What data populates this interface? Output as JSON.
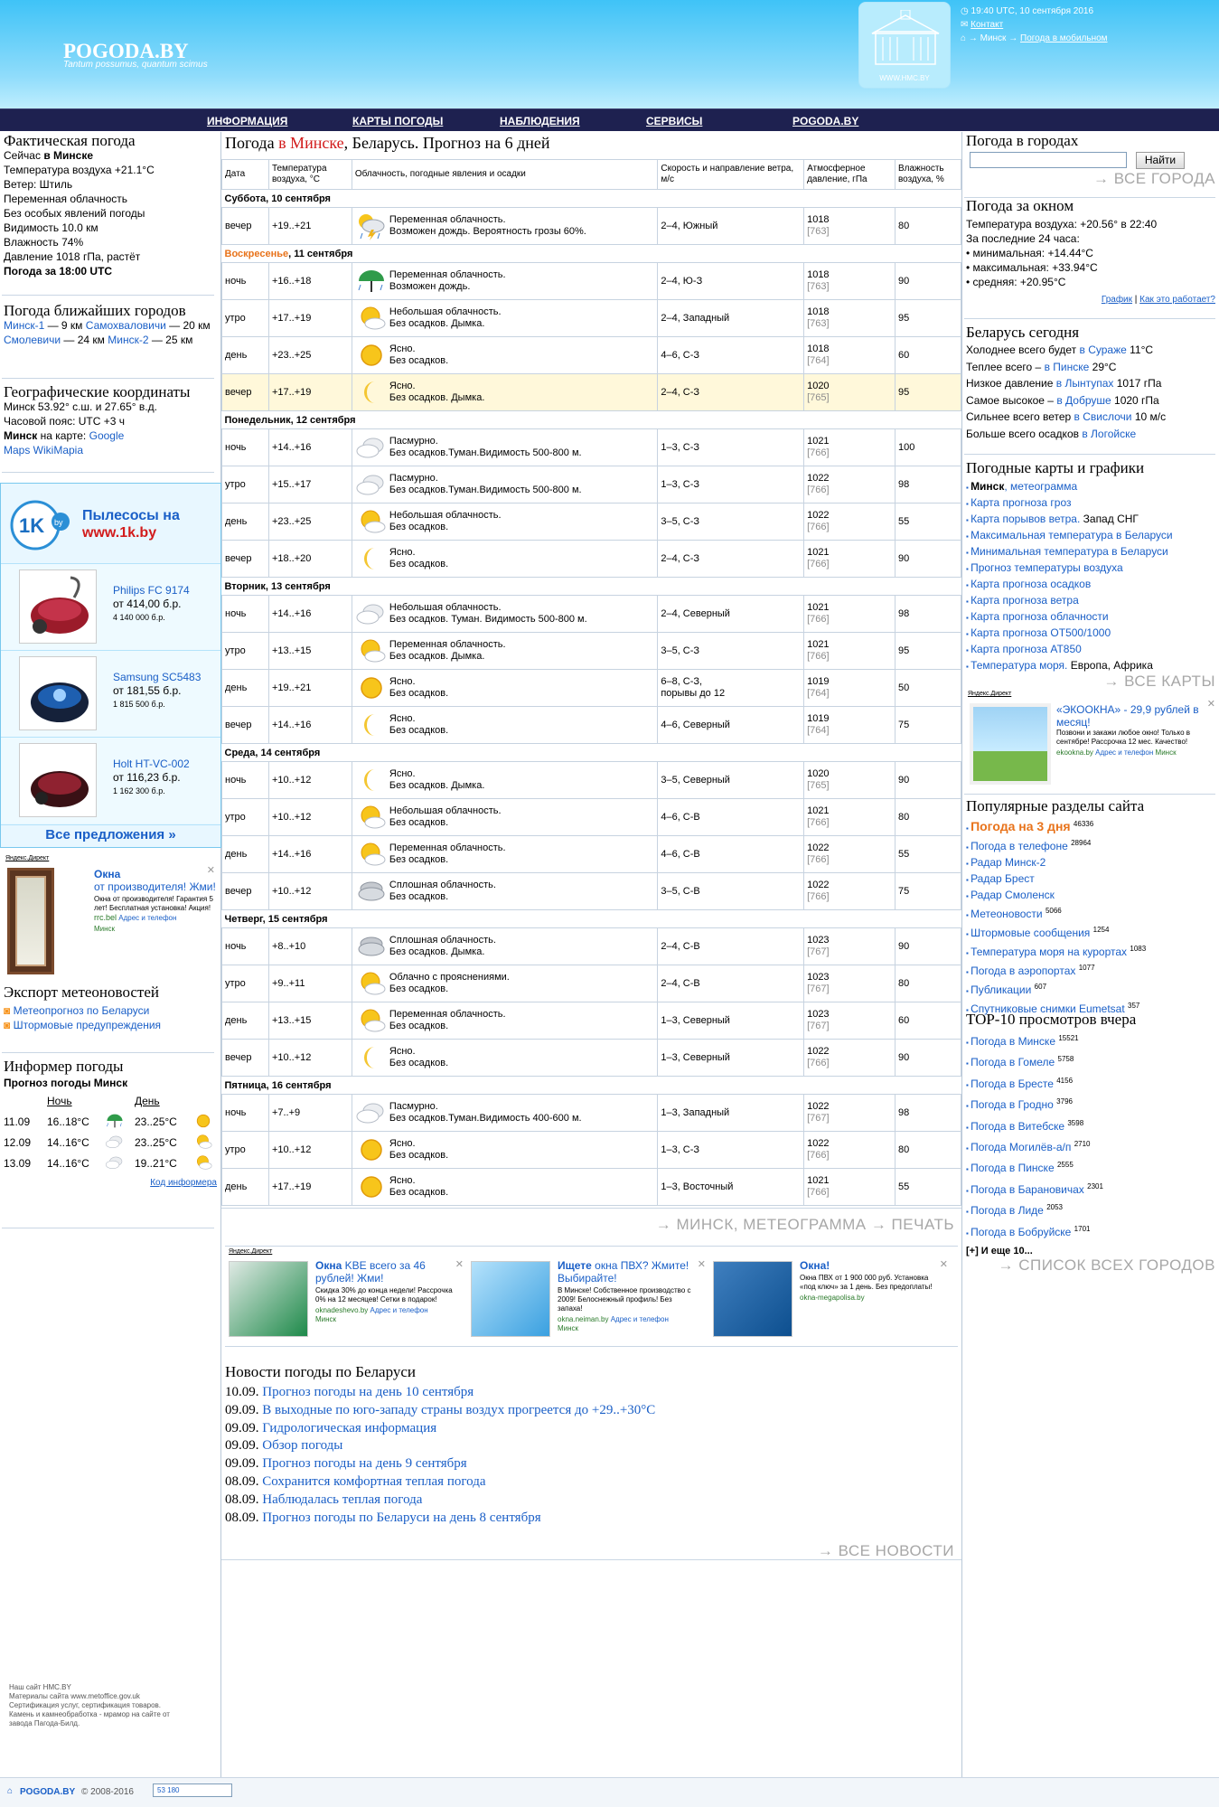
{
  "header": {
    "logo": "POGODA.BY",
    "slogan": "Tantum possumus, quantum scimus",
    "hmc_caption": "WWW.HMC.BY",
    "time": "19:40 UTC, 10 сентября 2016",
    "contact": "Контакт",
    "crumb_arrow": "→",
    "crumb_minsk": "Минск",
    "crumb_mobile": "Погода в мобильном"
  },
  "nav": [
    "ИНФОРМАЦИЯ",
    "КАРТЫ ПОГОДЫ",
    "НАБЛЮДЕНИЯ",
    "СЕРВИСЫ",
    "POGODA.BY"
  ],
  "left": {
    "actual_title": "Фактическая погода",
    "actual_lines": [
      "Сейчас в Минске",
      "Температура воздуха +21.1°C",
      "Ветер: Штиль",
      "Переменная облачность",
      "Без особых явлений погоды",
      "Видимость 10.0 км",
      "Влажность 74%",
      "Давление 1018 гПа, растёт",
      "Погода за 18:00 UTC"
    ],
    "nearby_title": "Погода ближайших городов",
    "nearby": [
      {
        "name": "Минск-1",
        "dist": "— 9 км"
      },
      {
        "name": "Самохваловичи",
        "dist": "— 20 км"
      },
      {
        "name": "Смолевичи",
        "dist": "— 24 км"
      },
      {
        "name": "Минск-2",
        "dist": "— 25 км"
      }
    ],
    "geo_title": "Географические координаты",
    "geo_line1": "Минск 53.92° с.ш. и 27.65° в.д.",
    "geo_line2": "Часовой пояс: UTC +3 ч",
    "geo_line3_a": "Минск на карте:",
    "geo_line3_b": "Google",
    "geo_line4": "Maps WikiMapia",
    "ad1k": {
      "title1": "Пылесосы на",
      "title2": "www.1k.by",
      "logo": "1K",
      "logo_sub": "by",
      "products": [
        {
          "name": "Philips FC 9174",
          "price": "от 414,00 б.р.",
          "old": "4 140 000 б.р."
        },
        {
          "name": "Samsung SC5483",
          "price": "от 181,55 б.р.",
          "old": "1 815 500 б.р."
        },
        {
          "name": "Holt HT-VC-002",
          "price": "от 116,23 б.р.",
          "old": "1 162 300 б.р."
        }
      ],
      "all": "Все предложения »"
    },
    "ad_windows": {
      "label": "Яндекс.Директ",
      "title": "Окна",
      "subtitle": "от производителя! Жми!",
      "text": "Окна от производителя! Гарантия 5 лет! Бесплатная установка! Акция!",
      "site": "rrc.bel",
      "addr": "Адрес и телефон",
      "city": "Минск"
    },
    "export_title": "Экспорт метеоновостей",
    "export_items": [
      "Метеопрогноз по Беларуси",
      "Штормовые предупреждения"
    ],
    "informer_title": "Информер погоды",
    "informer_sub": "Прогноз погоды Минск",
    "informer_night": "Ночь",
    "informer_day": "День",
    "informer_rows": [
      {
        "date": "11.09",
        "night": "16..18°C",
        "day": "23..25°C"
      },
      {
        "date": "12.09",
        "night": "14..16°C",
        "day": "23..25°C"
      },
      {
        "date": "13.09",
        "night": "14..16°C",
        "day": "19..21°C"
      }
    ],
    "informer_code": "Код информера",
    "footer_text": [
      "Наш сайт HMC.BY",
      "Материалы сайта www.metoffice.gov.uk",
      "Сертификация услуг, сертификация товаров.",
      "Камень и камнеобработка - мрамор на сайте от",
      "завода Пагода-Билд."
    ]
  },
  "main": {
    "title_a": "Погода",
    "title_b": "в Минске",
    "title_c": ", Беларусь. Прогноз на 6 дней",
    "cols": [
      "Дата",
      "Температура воздуха, °C",
      "Облачность, погодные явления и осадки",
      "Скорость и направление ветра, м/с",
      "Атмосферное давление, гПа",
      "Влажность воздуха, %"
    ],
    "days": [
      {
        "label": "Суббота, 10 сентября",
        "rows": [
          {
            "t": "вечер",
            "temp": "+19..+21",
            "icon": "storm",
            "d1": "Переменная облачность.",
            "d2": "Возможен дождь. Вероятность грозы 60%.",
            "wind": "2–4, Южный",
            "p": "1018",
            "pm": "[763]",
            "h": "80"
          }
        ]
      },
      {
        "label": "Воскресенье",
        "label2": ", 11 сентября",
        "rows": [
          {
            "t": "ночь",
            "temp": "+16..+18",
            "icon": "rain",
            "d1": "Переменная облачность.",
            "d2": "Возможен дождь.",
            "wind": "2–4, Ю-З",
            "p": "1018",
            "pm": "[763]",
            "h": "90"
          },
          {
            "t": "утро",
            "temp": "+17..+19",
            "icon": "partly",
            "d1": "Небольшая облачность.",
            "d2": "Без осадков. Дымка.",
            "wind": "2–4, Западный",
            "p": "1018",
            "pm": "[763]",
            "h": "95"
          },
          {
            "t": "день",
            "temp": "+23..+25",
            "icon": "sun",
            "d1": "Ясно.",
            "d2": "Без осадков.",
            "wind": "4–6, С-З",
            "p": "1018",
            "pm": "[764]",
            "h": "60"
          },
          {
            "t": "вечер",
            "temp": "+17..+19",
            "icon": "moon",
            "d1": "Ясно.",
            "d2": "Без осадков. Дымка.",
            "wind": "2–4, С-З",
            "p": "1020",
            "pm": "[765]",
            "h": "95",
            "hl": true
          }
        ]
      },
      {
        "label": "Понедельник, 12 сентября",
        "rows": [
          {
            "t": "ночь",
            "temp": "+14..+16",
            "icon": "cloud",
            "d1": "Пасмурно.",
            "d2": "Без осадков.Туман.Видимость 500-800 м.",
            "wind": "1–3, С-З",
            "p": "1021",
            "pm": "[766]",
            "h": "100"
          },
          {
            "t": "утро",
            "temp": "+15..+17",
            "icon": "cloud",
            "d1": "Пасмурно.",
            "d2": "Без осадков.Туман.Видимость 500-800 м.",
            "wind": "1–3, С-З",
            "p": "1022",
            "pm": "[766]",
            "h": "98"
          },
          {
            "t": "день",
            "temp": "+23..+25",
            "icon": "partly",
            "d1": "Небольшая облачность.",
            "d2": "Без осадков.",
            "wind": "3–5, С-З",
            "p": "1022",
            "pm": "[766]",
            "h": "55"
          },
          {
            "t": "вечер",
            "temp": "+18..+20",
            "icon": "moon",
            "d1": "Ясно.",
            "d2": "Без осадков.",
            "wind": "2–4, С-З",
            "p": "1021",
            "pm": "[766]",
            "h": "90"
          }
        ]
      },
      {
        "label": "Вторник, 13 сентября",
        "rows": [
          {
            "t": "ночь",
            "temp": "+14..+16",
            "icon": "cloud",
            "d1": "Небольшая облачность.",
            "d2": "Без осадков. Туман. Видимость 500-800 м.",
            "wind": "2–4, Северный",
            "p": "1021",
            "pm": "[766]",
            "h": "98"
          },
          {
            "t": "утро",
            "temp": "+13..+15",
            "icon": "partly",
            "d1": "Переменная облачность.",
            "d2": "Без осадков. Дымка.",
            "wind": "3–5, С-З",
            "p": "1021",
            "pm": "[766]",
            "h": "95"
          },
          {
            "t": "день",
            "temp": "+19..+21",
            "icon": "sun",
            "d1": "Ясно.",
            "d2": "Без осадков.",
            "wind": "6–8, С-З,",
            "wind2": "порывы до 12",
            "p": "1019",
            "pm": "[764]",
            "h": "50"
          },
          {
            "t": "вечер",
            "temp": "+14..+16",
            "icon": "moon",
            "d1": "Ясно.",
            "d2": "Без осадков.",
            "wind": "4–6, Северный",
            "p": "1019",
            "pm": "[764]",
            "h": "75"
          }
        ]
      },
      {
        "label": "Среда, 14 сентября",
        "rows": [
          {
            "t": "ночь",
            "temp": "+10..+12",
            "icon": "moon",
            "d1": "Ясно.",
            "d2": "Без осадков. Дымка.",
            "wind": "3–5, Северный",
            "p": "1020",
            "pm": "[765]",
            "h": "90"
          },
          {
            "t": "утро",
            "temp": "+10..+12",
            "icon": "partly",
            "d1": "Небольшая облачность.",
            "d2": "Без осадков.",
            "wind": "4–6, С-В",
            "p": "1021",
            "pm": "[766]",
            "h": "80"
          },
          {
            "t": "день",
            "temp": "+14..+16",
            "icon": "partly",
            "d1": "Переменная облачность.",
            "d2": "Без осадков.",
            "wind": "4–6, С-В",
            "p": "1022",
            "pm": "[766]",
            "h": "55"
          },
          {
            "t": "вечер",
            "temp": "+10..+12",
            "icon": "overcast",
            "d1": "Сплошная облачность.",
            "d2": "Без осадков.",
            "wind": "3–5, С-В",
            "p": "1022",
            "pm": "[766]",
            "h": "75"
          }
        ]
      },
      {
        "label": "Четверг, 15 сентября",
        "rows": [
          {
            "t": "ночь",
            "temp": "+8..+10",
            "icon": "overcast",
            "d1": "Сплошная облачность.",
            "d2": "Без осадков. Дымка.",
            "wind": "2–4, С-В",
            "p": "1023",
            "pm": "[767]",
            "h": "90"
          },
          {
            "t": "утро",
            "temp": "+9..+11",
            "icon": "partly",
            "d1": "Облачно с прояснениями.",
            "d2": "Без осадков.",
            "wind": "2–4, С-В",
            "p": "1023",
            "pm": "[767]",
            "h": "80"
          },
          {
            "t": "день",
            "temp": "+13..+15",
            "icon": "partly",
            "d1": "Переменная облачность.",
            "d2": "Без осадков.",
            "wind": "1–3, Северный",
            "p": "1023",
            "pm": "[767]",
            "h": "60"
          },
          {
            "t": "вечер",
            "temp": "+10..+12",
            "icon": "moon",
            "d1": "Ясно.",
            "d2": "Без осадков.",
            "wind": "1–3, Северный",
            "p": "1022",
            "pm": "[766]",
            "h": "90"
          }
        ]
      },
      {
        "label": "Пятница, 16 сентября",
        "rows": [
          {
            "t": "ночь",
            "temp": "+7..+9",
            "icon": "cloud",
            "d1": "Пасмурно.",
            "d2": "Без осадков.Туман.Видимость 400-600 м.",
            "wind": "1–3, Западный",
            "p": "1022",
            "pm": "[767]",
            "h": "98"
          },
          {
            "t": "утро",
            "temp": "+10..+12",
            "icon": "sun",
            "d1": "Ясно.",
            "d2": "Без осадков.",
            "wind": "1–3, С-З",
            "p": "1022",
            "pm": "[766]",
            "h": "80"
          },
          {
            "t": "день",
            "temp": "+17..+19",
            "icon": "sun",
            "d1": "Ясно.",
            "d2": "Без осадков.",
            "wind": "1–3, Восточный",
            "p": "1021",
            "pm": "[766]",
            "h": "55"
          }
        ]
      }
    ],
    "bottom_links": "→ МИНСК, МЕТЕОГРАММА   → ПЕЧАТЬ",
    "ads": [
      {
        "title": "Окна",
        "title2": "KBE всего за 46 рублей! Жми!",
        "text": "Скидка 30% до конца недели! Рассрочка 0% на 12 месяцев! Сетки в подарок!",
        "site": "oknadeshevo.by",
        "addr": "Адрес и телефон",
        "city": "Минск"
      },
      {
        "title": "Ищете",
        "title2": "окна ПВХ? Жмите! Выбирайте!",
        "text": "В Минске! Собственное производство с 2009! Белоснежный профиль! Без запаха!",
        "site": "okna.neiman.by",
        "addr": "Адрес и телефон",
        "city": "Минск"
      },
      {
        "title": "Окна!",
        "title2": "",
        "text": "Окна ПВХ от 1 900 000 руб. Установка «под ключ» за 1 день. Без предоплаты!",
        "site": "okna-megapolisa.by",
        "addr": "",
        "city": ""
      }
    ],
    "ads_label": "Яндекс.Директ",
    "news_title": "Новости погоды по Беларуси",
    "news": [
      {
        "date": "10.09.",
        "text": "Прогноз погоды на день 10 сентября"
      },
      {
        "date": "09.09.",
        "text": "В выходные по юго-западу страны воздух прогреется до +29..+30°C"
      },
      {
        "date": "09.09.",
        "text": "Гидрологическая информация"
      },
      {
        "date": "09.09.",
        "text": "Обзор погоды"
      },
      {
        "date": "09.09.",
        "text": "Прогноз погоды на день 9 сентября"
      },
      {
        "date": "08.09.",
        "text": "Сохранится комфортная теплая погода"
      },
      {
        "date": "08.09.",
        "text": "Наблюдалась теплая погода"
      },
      {
        "date": "08.09.",
        "text": "Прогноз погоды по Беларуси на день 8 сентября"
      }
    ],
    "all_news": "→ ВСЕ НОВОСТИ"
  },
  "right": {
    "cities_title": "Погода в городах",
    "find": "Найти",
    "all_cities": "→ ВСЕ ГОРОДА",
    "window_title": "Погода за окном",
    "window_lines": [
      "Температура воздуха: +20.56° в 22:40",
      "За последние 24 часа:",
      "• минимальная: +14.44°C",
      "• максимальная: +33.94°C",
      "• средняя: +20.95°C"
    ],
    "graph": "График",
    "how": "Как это работает?",
    "today_title": "Беларусь сегодня",
    "today": [
      {
        "a": "Холоднее всего будет",
        "b": "в Сураже",
        "c": "11°C"
      },
      {
        "a": "Теплее всего –",
        "b": "в Пинске",
        "c": "29°C"
      },
      {
        "a": "Низкое давление",
        "b": "в Лынтупах",
        "c": "1017 гПа"
      },
      {
        "a": "Самое высокое –",
        "b": "в Добруше",
        "c": "1020 гПа"
      },
      {
        "a": "Сильнее всего ветер",
        "b": "в Свислочи",
        "c": "10 м/с"
      },
      {
        "a": "Больше всего осадков",
        "b": "в Логойске",
        "c": ""
      }
    ],
    "maps_title": "Погодные карты и графики",
    "maps": [
      {
        "a": "Минск",
        "b": ", метеограмма"
      },
      {
        "b": "Карта прогноза гроз"
      },
      {
        "b": "Карта порывов ветра.",
        "c": "Запад СНГ"
      },
      {
        "b": "Максимальная температура в Беларуси"
      },
      {
        "b": "Минимальная температура в Беларуси"
      },
      {
        "b": "Прогноз температуры воздуха"
      },
      {
        "b": "Карта прогноза осадков"
      },
      {
        "b": "Карта прогноза ветра"
      },
      {
        "b": "Карта прогноза облачности"
      },
      {
        "b": "Карта прогноза ОТ500/1000"
      },
      {
        "b": "Карта прогноза АТ850"
      },
      {
        "b": "Температура моря.",
        "c": "Европа, Африка"
      }
    ],
    "all_maps": "→ ВСЕ КАРТЫ",
    "ad": {
      "label": "Яндекс.Директ",
      "title": "«ЭКООКНА» - 29,9 рублей в месяц!",
      "text": "Позвони и закажи любое окно! Только в сентябре! Рассрочка 12 мес. Качество!",
      "site": "ekookna.by",
      "addr": "Адрес и телефон",
      "city": "Минск"
    },
    "popular_title": "Популярные разделы сайта",
    "popular": [
      {
        "t": "Погода на 3 дня",
        "n": "46336",
        "hot": true
      },
      {
        "t": "Погода в телефоне",
        "n": "28964"
      },
      {
        "t": "Радар Минск-2",
        "n": ""
      },
      {
        "t": "Радар Брест",
        "n": ""
      },
      {
        "t": "Радар Смоленск",
        "n": ""
      },
      {
        "t": "Метеоновости",
        "n": "5066"
      },
      {
        "t": "Штормовые сообщения",
        "n": "1254"
      },
      {
        "t": "Температура моря на курортах",
        "n": "1083"
      },
      {
        "t": "Погода в аэропортах",
        "n": "1077"
      },
      {
        "t": "Публикации",
        "n": "607"
      },
      {
        "t": "Спутниковые снимки Eumetsat",
        "n": "357"
      }
    ],
    "top_title": "TOP-10 просмотров вчера",
    "top": [
      {
        "t": "Погода в Минске",
        "n": "15521"
      },
      {
        "t": "Погода в Гомеле",
        "n": "5758"
      },
      {
        "t": "Погода в Бресте",
        "n": "4156"
      },
      {
        "t": "Погода в Гродно",
        "n": "3796"
      },
      {
        "t": "Погода в Витебске",
        "n": "3598"
      },
      {
        "t": "Погода Могилёв-а/п",
        "n": "2710"
      },
      {
        "t": "Погода в Пинске",
        "n": "2555"
      },
      {
        "t": "Погода в Барановичах",
        "n": "2301"
      },
      {
        "t": "Погода в Лиде",
        "n": "2053"
      },
      {
        "t": "Погода в Бобруйске",
        "n": "1701"
      }
    ],
    "more": "[+] И еще 10...",
    "all_list": "→ СПИСОК ВСЕХ ГОРОДОВ"
  },
  "footer": {
    "brand": "POGODA.BY",
    "copy": "© 2008-2016",
    "counter": "53 180"
  },
  "colors": {
    "sky": "#3fc3f7",
    "nav": "#1e2150",
    "link": "#1a5fc7",
    "sunday": "#e8731b",
    "hot": "#e8731b"
  }
}
